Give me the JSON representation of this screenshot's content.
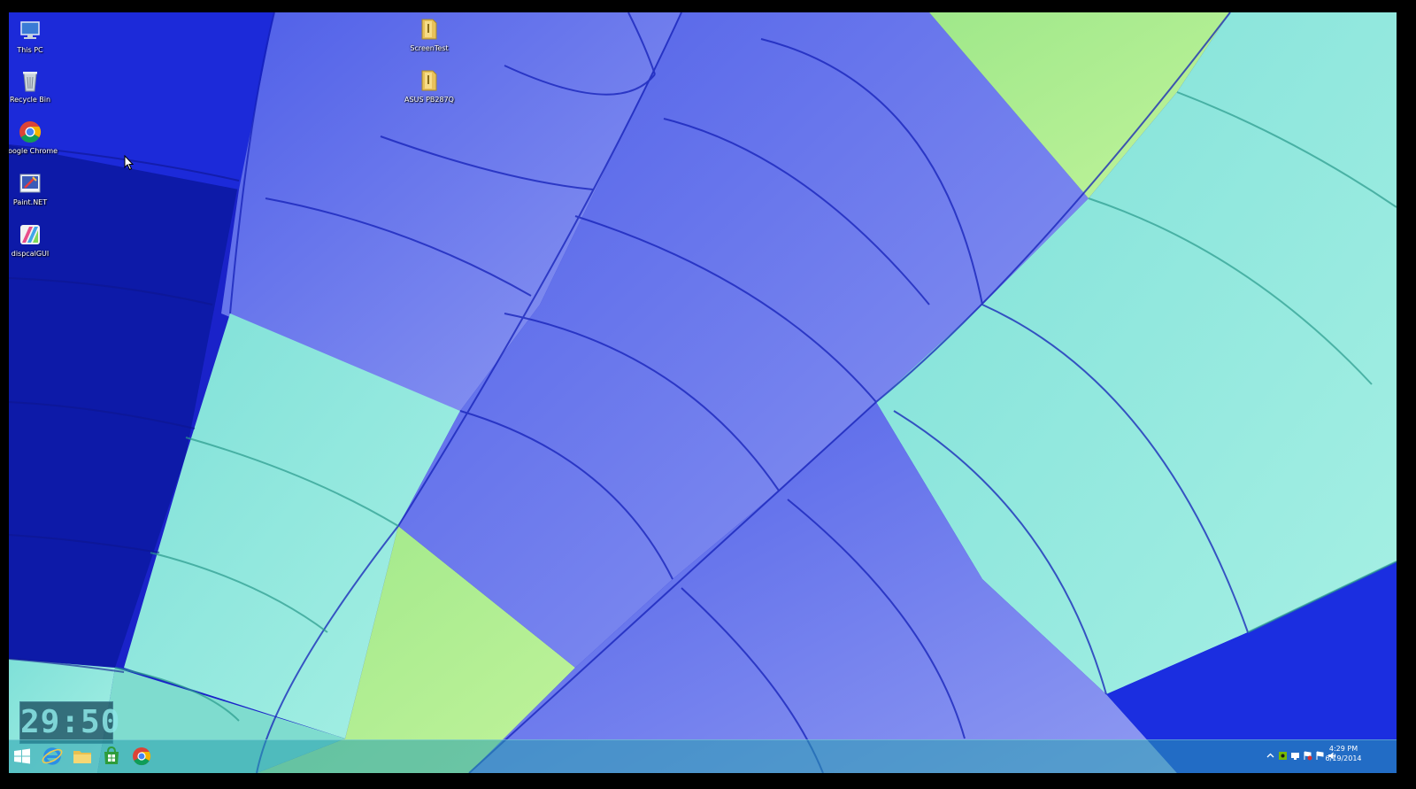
{
  "desktop": {
    "icons_left": [
      {
        "label": "This PC",
        "icon": "computer-icon"
      },
      {
        "label": "Recycle Bin",
        "icon": "recycle-bin-icon"
      },
      {
        "label": "Google Chrome",
        "icon": "chrome-icon"
      },
      {
        "label": "Paint.NET",
        "icon": "paint-net-icon"
      },
      {
        "label": "dispcalGUI",
        "icon": "dispcalgui-icon"
      }
    ],
    "icons_middle": [
      {
        "label": "ScreenTest",
        "icon": "folder-icon"
      },
      {
        "label": "ASUS PB287Q",
        "icon": "folder-icon"
      }
    ]
  },
  "clock_widget": {
    "time": "29:50"
  },
  "taskbar": {
    "pinned": [
      {
        "name": "start",
        "icon": "windows-logo-icon"
      },
      {
        "name": "internet-explorer",
        "icon": "internet-explorer-icon"
      },
      {
        "name": "file-explorer",
        "icon": "file-explorer-icon"
      },
      {
        "name": "store",
        "icon": "store-icon"
      },
      {
        "name": "chrome",
        "icon": "chrome-icon"
      }
    ],
    "tray": {
      "icons": [
        "show-hidden-icons",
        "nvidia-icon",
        "network-icon",
        "action-center-flag-icon",
        "flag-icon",
        "volume-icon"
      ],
      "time": "4:29 PM",
      "date": "6/19/2014"
    }
  },
  "colors": {
    "deep_blue": "#1b2fe0",
    "periwinkle": "#6b78ef",
    "aqua": "#8ee6dc",
    "lime": "#aaf08a"
  }
}
